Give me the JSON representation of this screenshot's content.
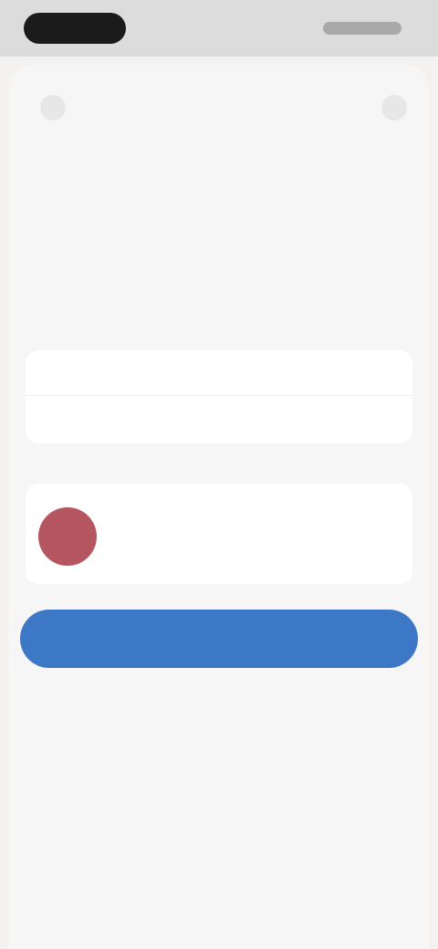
{
  "status_bar": {
    "left": "",
    "right": ""
  },
  "header": {
    "left_control": "",
    "right_control": ""
  },
  "page": {
    "title": "",
    "subtitle": ""
  },
  "summary": {
    "rows": [
      {
        "label": "",
        "value": ""
      },
      {
        "label": "",
        "value": ""
      }
    ]
  },
  "notice": {
    "text": "",
    "link": ""
  },
  "actions": {
    "primary_label": "",
    "secondary_label": ""
  },
  "colors": {
    "primary": "#3d78c6",
    "avatar": "#b45560",
    "background": "#f3f2f1",
    "card": "#ffffff"
  }
}
